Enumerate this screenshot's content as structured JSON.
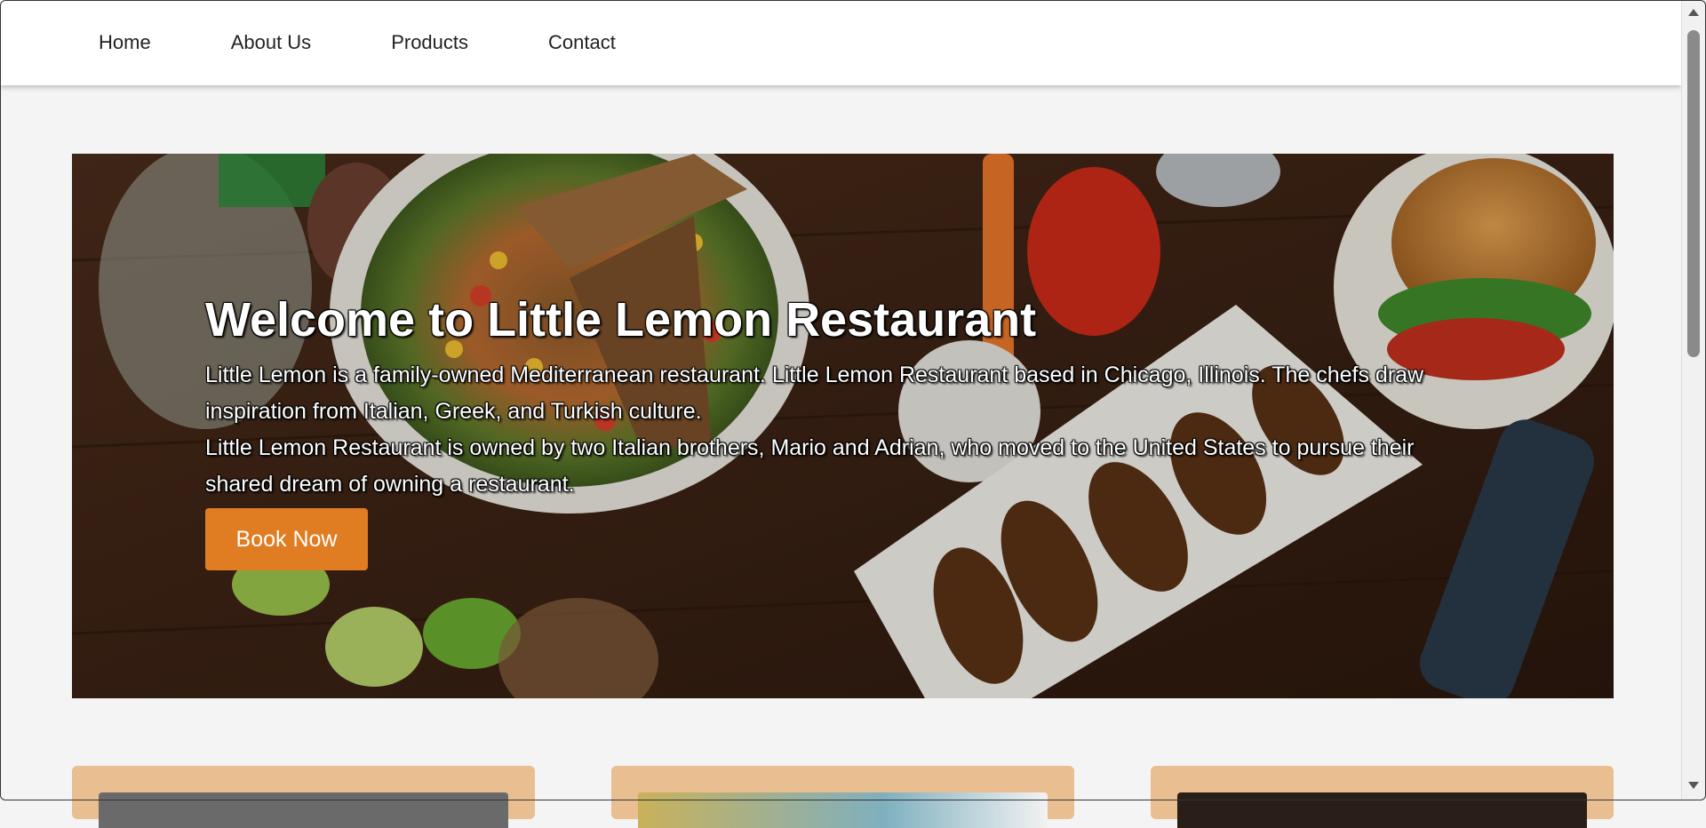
{
  "nav": {
    "items": [
      {
        "label": "Home"
      },
      {
        "label": "About Us"
      },
      {
        "label": "Products"
      },
      {
        "label": "Contact"
      }
    ]
  },
  "hero": {
    "title": "Welcome to Little Lemon Restaurant",
    "paragraph1": "Little Lemon is a family-owned Mediterranean restaurant. Little Lemon Restaurant based in Chicago, Illinois. The chefs draw inspiration from Italian, Greek, and Turkish culture.",
    "paragraph2": "Little Lemon Restaurant is owned by two Italian brothers, Mario and Adrian, who moved to the United States to pursue their shared dream of owning a restaurant.",
    "button_label": "Book Now"
  },
  "colors": {
    "accent": "#e07d22",
    "card_background": "#e9be90",
    "page_background": "#f4f4f4"
  }
}
